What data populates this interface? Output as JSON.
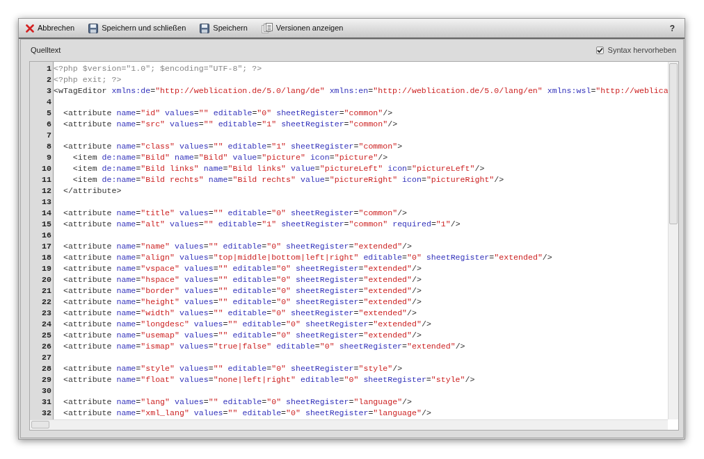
{
  "toolbar": {
    "buttons": [
      {
        "kind": "cancel",
        "label": "Abbrechen"
      },
      {
        "kind": "save",
        "label": "Speichern und schließen"
      },
      {
        "kind": "save",
        "label": "Speichern"
      },
      {
        "kind": "versions",
        "label": "Versionen anzeigen"
      }
    ],
    "help": "?"
  },
  "panel": {
    "title": "Quelltext",
    "syntax_highlight": {
      "label": "Syntax hervorheben",
      "checked": true
    }
  },
  "editor": {
    "lines": [
      {
        "number": "1",
        "code": "<?php $version=\"1.0\"; $encoding=\"UTF-8\"; ?>"
      },
      {
        "number": "2",
        "code": "<?php exit; ?>"
      },
      {
        "number": "3",
        "code": "<wTagEditor xmlns:de=\"http://weblication.de/5.0/lang/de\" xmlns:en=\"http://weblication.de/5.0/lang/en\" xmlns:wsl=\"http://weblica"
      },
      {
        "number": "4"
      },
      {
        "number": "5",
        "code": "  <attribute name=\"id\" values=\"\" editable=\"0\" sheetRegister=\"common\"/>"
      },
      {
        "number": "6",
        "code": "  <attribute name=\"src\" values=\"\" editable=\"1\" sheetRegister=\"common\"/>"
      },
      {
        "number": "7"
      },
      {
        "number": "8",
        "code": "  <attribute name=\"class\" values=\"\" editable=\"1\" sheetRegister=\"common\">"
      },
      {
        "number": "9",
        "code": "    <item de:name=\"Bild\" name=\"Bild\" value=\"picture\" icon=\"picture\"/>"
      },
      {
        "number": "10",
        "code": "    <item de:name=\"Bild links\" name=\"Bild links\" value=\"pictureLeft\" icon=\"pictureLeft\"/>"
      },
      {
        "number": "11",
        "code": "    <item de:name=\"Bild rechts\" name=\"Bild rechts\" value=\"pictureRight\" icon=\"pictureRight\"/>"
      },
      {
        "number": "12",
        "code": "  </attribute>"
      },
      {
        "number": "13"
      },
      {
        "number": "14",
        "code": "  <attribute name=\"title\" values=\"\" editable=\"0\" sheetRegister=\"common\"/>"
      },
      {
        "number": "15",
        "code": "  <attribute name=\"alt\" values=\"\" editable=\"1\" sheetRegister=\"common\" required=\"1\"/>"
      },
      {
        "number": "16"
      },
      {
        "number": "17",
        "code": "  <attribute name=\"name\" values=\"\" editable=\"0\" sheetRegister=\"extended\"/>"
      },
      {
        "number": "18",
        "code": "  <attribute name=\"align\" values=\"top|middle|bottom|left|right\" editable=\"0\" sheetRegister=\"extended\"/>"
      },
      {
        "number": "19",
        "code": "  <attribute name=\"vspace\" values=\"\" editable=\"0\" sheetRegister=\"extended\"/>"
      },
      {
        "number": "20",
        "code": "  <attribute name=\"hspace\" values=\"\" editable=\"0\" sheetRegister=\"extended\"/>"
      },
      {
        "number": "21",
        "code": "  <attribute name=\"border\" values=\"\" editable=\"0\" sheetRegister=\"extended\"/>"
      },
      {
        "number": "22",
        "code": "  <attribute name=\"height\" values=\"\" editable=\"0\" sheetRegister=\"extended\"/>"
      },
      {
        "number": "23",
        "code": "  <attribute name=\"width\" values=\"\" editable=\"0\" sheetRegister=\"extended\"/>"
      },
      {
        "number": "24",
        "code": "  <attribute name=\"longdesc\" values=\"\" editable=\"0\" sheetRegister=\"extended\"/>"
      },
      {
        "number": "25",
        "code": "  <attribute name=\"usemap\" values=\"\" editable=\"0\" sheetRegister=\"extended\"/>"
      },
      {
        "number": "26",
        "code": "  <attribute name=\"ismap\" values=\"true|false\" editable=\"0\" sheetRegister=\"extended\"/>"
      },
      {
        "number": "27"
      },
      {
        "number": "28",
        "code": "  <attribute name=\"style\" values=\"\" editable=\"0\" sheetRegister=\"style\"/>"
      },
      {
        "number": "29",
        "code": "  <attribute name=\"float\" values=\"none|left|right\" editable=\"0\" sheetRegister=\"style\"/>"
      },
      {
        "number": "30"
      },
      {
        "number": "31",
        "code": "  <attribute name=\"lang\" values=\"\" editable=\"0\" sheetRegister=\"language\"/>"
      },
      {
        "number": "32",
        "code": "  <attribute name=\"xml_lang\" values=\"\" editable=\"0\" sheetRegister=\"language\"/>"
      }
    ]
  }
}
